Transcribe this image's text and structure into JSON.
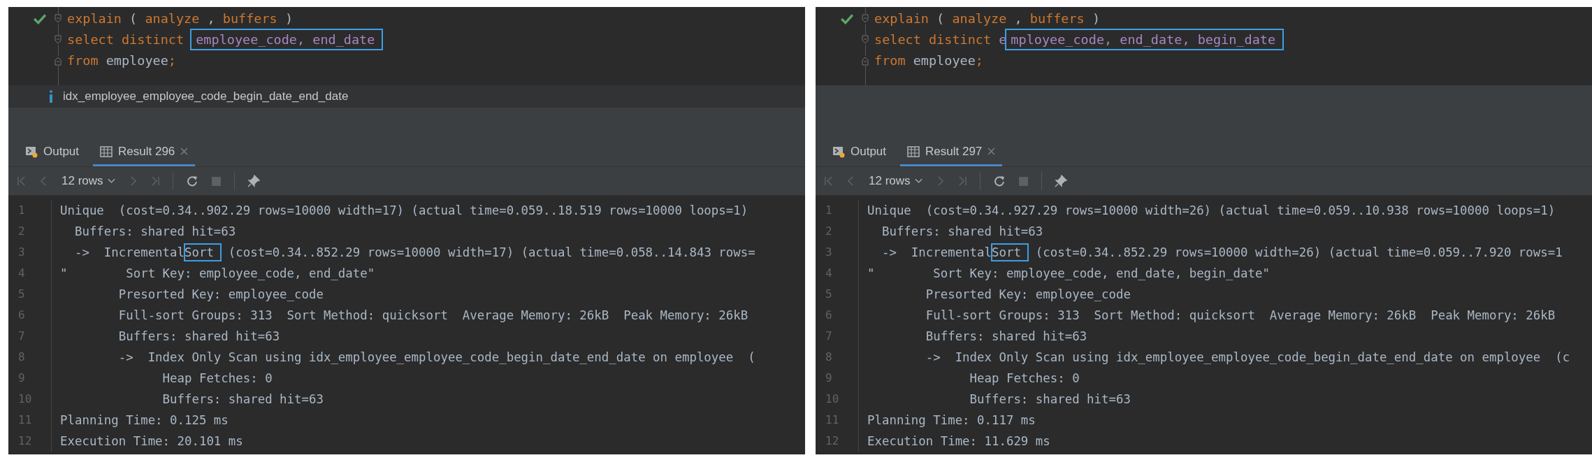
{
  "panels": [
    {
      "editor": {
        "lines": [
          {
            "tokens": [
              {
                "text": "explain",
                "kind": "keyword"
              },
              {
                "text": " ( ",
                "kind": "punct"
              },
              {
                "text": "analyze",
                "kind": "keyword"
              },
              {
                "text": " , ",
                "kind": "punct"
              },
              {
                "text": "buffers",
                "kind": "keyword"
              },
              {
                "text": " )",
                "kind": "punct"
              }
            ]
          },
          {
            "tokens": [
              {
                "text": "select distinct ",
                "kind": "keyword"
              },
              {
                "text": "employee_code, end_date",
                "kind": "column",
                "highlighted": true
              }
            ]
          },
          {
            "tokens": [
              {
                "text": "from ",
                "kind": "keyword"
              },
              {
                "text": "employee",
                "kind": "plain"
              },
              {
                "text": ";",
                "kind": "keyword"
              }
            ]
          }
        ]
      },
      "hint": "idx_employee_employee_code_begin_date_end_date",
      "tabs": [
        {
          "label": "Output",
          "kind": "output",
          "selected": false
        },
        {
          "label": "Result 296",
          "kind": "result",
          "selected": true
        }
      ],
      "rows_label": "12 rows",
      "result_lines": [
        {
          "number": "1",
          "segments": [
            {
              "text": "Unique  (cost=0.34..902.29 rows=10000 width=17) (actual time=0.059..18.519 rows=10000 loops=1)",
              "highlighted": false
            }
          ]
        },
        {
          "number": "2",
          "segments": [
            {
              "text": "  Buffers: shared hit=63",
              "highlighted": false
            }
          ]
        },
        {
          "number": "3",
          "segments": [
            {
              "text": "  ->  Incremental",
              "highlighted": false
            },
            {
              "text": "Sort ",
              "highlighted": true
            },
            {
              "text": " (cost=0.34..852.29 rows=10000 width=17) (actual time=0.058..14.843 rows=",
              "highlighted": false
            }
          ]
        },
        {
          "number": "4",
          "segments": [
            {
              "text": "\"        Sort Key: employee_code, end_date\"",
              "highlighted": false
            }
          ]
        },
        {
          "number": "5",
          "segments": [
            {
              "text": "        Presorted Key: employee_code",
              "highlighted": false
            }
          ]
        },
        {
          "number": "6",
          "segments": [
            {
              "text": "        Full-sort Groups: 313  Sort Method: quicksort  Average Memory: 26kB  Peak Memory: 26kB",
              "highlighted": false
            }
          ]
        },
        {
          "number": "7",
          "segments": [
            {
              "text": "        Buffers: shared hit=63",
              "highlighted": false
            }
          ]
        },
        {
          "number": "8",
          "segments": [
            {
              "text": "        ->  Index Only Scan using idx_employee_employee_code_begin_date_end_date on employee  (",
              "highlighted": false
            }
          ]
        },
        {
          "number": "9",
          "segments": [
            {
              "text": "              Heap Fetches: 0",
              "highlighted": false
            }
          ]
        },
        {
          "number": "10",
          "segments": [
            {
              "text": "              Buffers: shared hit=63",
              "highlighted": false
            }
          ]
        },
        {
          "number": "11",
          "segments": [
            {
              "text": "Planning Time: 0.125 ms",
              "highlighted": false
            }
          ]
        },
        {
          "number": "12",
          "segments": [
            {
              "text": "Execution Time: 20.101 ms",
              "highlighted": false
            }
          ]
        }
      ]
    },
    {
      "editor": {
        "lines": [
          {
            "tokens": [
              {
                "text": "explain",
                "kind": "keyword"
              },
              {
                "text": " ( ",
                "kind": "punct"
              },
              {
                "text": "analyze",
                "kind": "keyword"
              },
              {
                "text": " , ",
                "kind": "punct"
              },
              {
                "text": "buffers",
                "kind": "keyword"
              },
              {
                "text": " )",
                "kind": "punct"
              }
            ]
          },
          {
            "tokens": [
              {
                "text": "select distinct ",
                "kind": "keyword"
              },
              {
                "text": "e",
                "kind": "column"
              },
              {
                "text": "mployee_code, end_date, begin_date",
                "kind": "column",
                "highlighted": true
              }
            ]
          },
          {
            "tokens": [
              {
                "text": "from ",
                "kind": "keyword"
              },
              {
                "text": "employee",
                "kind": "plain"
              },
              {
                "text": ";",
                "kind": "keyword"
              }
            ]
          }
        ]
      },
      "tabs": [
        {
          "label": "Output",
          "kind": "output",
          "selected": false
        },
        {
          "label": "Result 297",
          "kind": "result",
          "selected": true
        }
      ],
      "rows_label": "12 rows",
      "result_lines": [
        {
          "number": "1",
          "segments": [
            {
              "text": "Unique  (cost=0.34..927.29 rows=10000 width=26) (actual time=0.059..10.938 rows=10000 loops=1)",
              "highlighted": false
            }
          ]
        },
        {
          "number": "2",
          "segments": [
            {
              "text": "  Buffers: shared hit=63",
              "highlighted": false
            }
          ]
        },
        {
          "number": "3",
          "segments": [
            {
              "text": "  ->  Incremental",
              "highlighted": false
            },
            {
              "text": "Sort ",
              "highlighted": true
            },
            {
              "text": " (cost=0.34..852.29 rows=10000 width=26) (actual time=0.059..7.920 rows=1",
              "highlighted": false
            }
          ]
        },
        {
          "number": "4",
          "segments": [
            {
              "text": "\"        Sort Key: employee_code, end_date, begin_date\"",
              "highlighted": false
            }
          ]
        },
        {
          "number": "5",
          "segments": [
            {
              "text": "        Presorted Key: employee_code",
              "highlighted": false
            }
          ]
        },
        {
          "number": "6",
          "segments": [
            {
              "text": "        Full-sort Groups: 313  Sort Method: quicksort  Average Memory: 26kB  Peak Memory: 26kB",
              "highlighted": false
            }
          ]
        },
        {
          "number": "7",
          "segments": [
            {
              "text": "        Buffers: shared hit=63",
              "highlighted": false
            }
          ]
        },
        {
          "number": "8",
          "segments": [
            {
              "text": "        ->  Index Only Scan using idx_employee_employee_code_begin_date_end_date on employee  (c",
              "highlighted": false
            }
          ]
        },
        {
          "number": "9",
          "segments": [
            {
              "text": "              Heap Fetches: 0",
              "highlighted": false
            }
          ]
        },
        {
          "number": "10",
          "segments": [
            {
              "text": "              Buffers: shared hit=63",
              "highlighted": false
            }
          ]
        },
        {
          "number": "11",
          "segments": [
            {
              "text": "Planning Time: 0.117 ms",
              "highlighted": false
            }
          ]
        },
        {
          "number": "12",
          "segments": [
            {
              "text": "Execution Time: 11.629 ms",
              "highlighted": false
            }
          ]
        }
      ]
    }
  ]
}
